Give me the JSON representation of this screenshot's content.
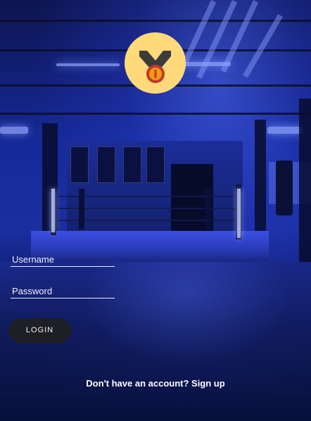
{
  "logo": {
    "icon": "medal-icon",
    "background_color": "#ffd97a"
  },
  "form": {
    "username_placeholder": "Username",
    "password_placeholder": "Password",
    "login_label": "LOGIN"
  },
  "footer": {
    "signup_text": "Don't have an account? Sign up"
  }
}
